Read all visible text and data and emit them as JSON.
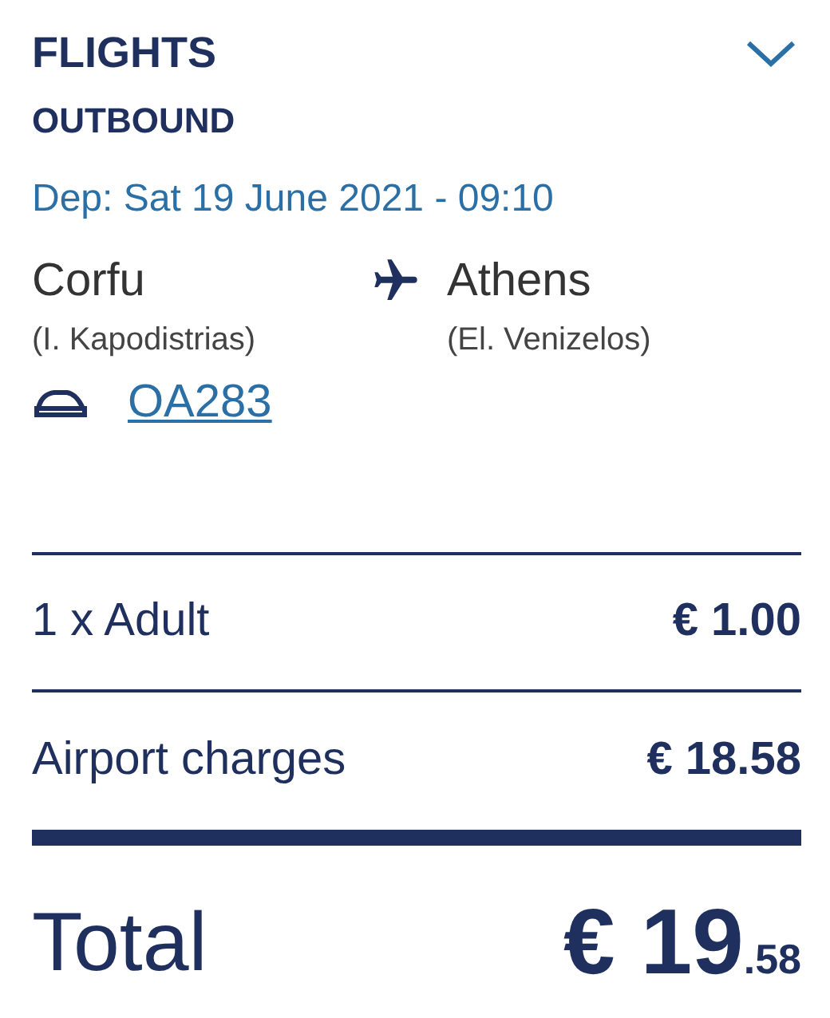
{
  "header": {
    "title": "FLIGHTS",
    "expanded": true
  },
  "leg": {
    "label": "OUTBOUND",
    "departure": "Dep: Sat 19 June 2021 - 09:10",
    "origin": {
      "city": "Corfu",
      "airport": "(I. Kapodistrias)"
    },
    "destination": {
      "city": "Athens",
      "airport": "(El. Venizelos)"
    },
    "flight_number": "OA283"
  },
  "charges": [
    {
      "label": "1 x Adult",
      "amount": "€ 1.00"
    },
    {
      "label": "Airport charges",
      "amount": "€ 18.58"
    }
  ],
  "total": {
    "label": "Total",
    "amount_main": "€ 19",
    "amount_cents": ".58"
  }
}
